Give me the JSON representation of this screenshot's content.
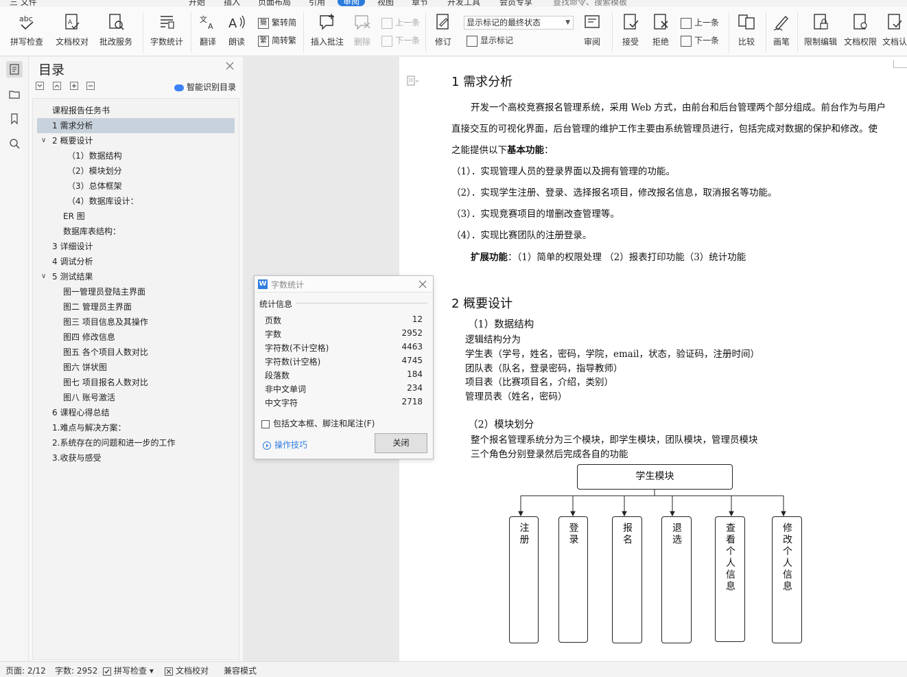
{
  "menu": {
    "items": [
      "三 文件",
      "开始",
      "插入",
      "页面布局",
      "引用",
      "审阅",
      "视图",
      "章节",
      "开发工具",
      "会员专享",
      "查找命令、搜索模板"
    ],
    "active_index": 5
  },
  "ribbon": {
    "spell_check": "拼写检查",
    "doc_proof": "文档校对",
    "batch_service": "批改服务",
    "word_count": "字数统计",
    "translate": "翻译",
    "read_aloud": "朗读",
    "trad_to_simp": "繁转简",
    "simp_to_trad": "简转繁",
    "insert_comment": "插入批注",
    "delete": "删除",
    "prev_comment": "上一条",
    "next_comment": "下一条",
    "revise": "修订",
    "markup_combo": "显示标记的最终状态",
    "show_markup": "显示标记",
    "review": "审阅",
    "accept": "接受",
    "reject": "拒绝",
    "prev_change": "上一条",
    "next_change": "下一条",
    "compare": "比较",
    "ink": "画笔",
    "restrict_edit": "限制编辑",
    "doc_permission": "文档权限",
    "doc_auth": "文档认"
  },
  "toc": {
    "title": "目录",
    "smart_label": "智能识别目录",
    "items": [
      {
        "label": "课程报告任务书",
        "indent": 0,
        "chev": ""
      },
      {
        "label": "1 需求分析",
        "indent": 0,
        "chev": "",
        "selected": true
      },
      {
        "label": "2 概要设计",
        "indent": 0,
        "chev": "v"
      },
      {
        "label": "（1）数据结构",
        "indent": 2,
        "chev": ""
      },
      {
        "label": "（2）模块划分",
        "indent": 2,
        "chev": ""
      },
      {
        "label": "（3）总体框架",
        "indent": 2,
        "chev": ""
      },
      {
        "label": "（4）数据库设计：",
        "indent": 2,
        "chev": ""
      },
      {
        "label": "ER 图",
        "indent": 1,
        "chev": ""
      },
      {
        "label": "数据库表结构：",
        "indent": 1,
        "chev": ""
      },
      {
        "label": "3 详细设计",
        "indent": 0,
        "chev": ""
      },
      {
        "label": "4 调试分析",
        "indent": 0,
        "chev": ""
      },
      {
        "label": "5   测试结果",
        "indent": 0,
        "chev": "v"
      },
      {
        "label": "图一管理员登陆主界面",
        "indent": 1,
        "chev": ""
      },
      {
        "label": "图二  管理员主界面",
        "indent": 1,
        "chev": ""
      },
      {
        "label": "图三  项目信息及其操作",
        "indent": 1,
        "chev": ""
      },
      {
        "label": "图四  修改信息",
        "indent": 1,
        "chev": ""
      },
      {
        "label": "图五  各个项目人数对比",
        "indent": 1,
        "chev": ""
      },
      {
        "label": "图六  饼状图",
        "indent": 1,
        "chev": ""
      },
      {
        "label": "图七  项目报名人数对比",
        "indent": 1,
        "chev": ""
      },
      {
        "label": "图八  账号激活",
        "indent": 1,
        "chev": ""
      },
      {
        "label": "6 课程心得总结",
        "indent": 0,
        "chev": ""
      },
      {
        "label": "1.难点与解决方案：",
        "indent": 0,
        "chev": ""
      },
      {
        "label": "2.系统存在的问题和进一步的工作",
        "indent": 0,
        "chev": ""
      },
      {
        "label": "3.收获与感受",
        "indent": 0,
        "chev": ""
      }
    ]
  },
  "doc": {
    "h1": "1  需求分析",
    "p1a": "开发一个高校竞赛报名管理系统，采用 Web 方式，由前台和后台管理两个部分组成。前台作为与用户",
    "p1b": "直接交互的可视化界面，后台管理的维护工作主要由系统管理员进行，包括完成对数据的保护和修改。使",
    "p1c_pre": "之能提供以下",
    "p1c_bold": "基本功能",
    "p1c_post": "：",
    "f1": "（1）．实现管理人员的登录界面以及拥有管理的功能。",
    "f2": "（2）．实现学生注册、登录、选择报名项目，修改报名信息，取消报名等功能。",
    "f3": "（3）．实现竞赛项目的增删改查管理等。",
    "f4": "（4）．实现比赛团队的注册登录。",
    "ext_bold": "扩展功能",
    "ext_text": "：（1）简单的权限处理  （2）报表打印功能（3）统计功能",
    "h2": "2  概要设计",
    "s1": "（1）数据结构",
    "l1": "逻辑结构分为",
    "l2": "学生表（学号，姓名，密码，学院，email，状态，验证码，注册时间）",
    "l3": "团队表（队名，登录密码，指导教师）",
    "l4": "项目表（比赛项目名，介绍，类别）",
    "l5": "管理员表（姓名，密码）",
    "s2": "（2）模块划分",
    "m1": "整个报名管理系统分为三个模块，即学生模块，团队模块，管理员模块",
    "m2": "三个角色分别登录然后完成各自的功能",
    "diagram": {
      "root": "学生模块",
      "children": [
        "注册",
        "登录",
        "报名",
        "退选",
        "查看个人信息",
        "修改个人信息"
      ]
    }
  },
  "dialog": {
    "title": "字数统计",
    "group": "统计信息",
    "rows": [
      {
        "k": "页数",
        "v": "12"
      },
      {
        "k": "字数",
        "v": "2952"
      },
      {
        "k": "字符数(不计空格)",
        "v": "4463"
      },
      {
        "k": "字符数(计空格)",
        "v": "4745"
      },
      {
        "k": "段落数",
        "v": "184"
      },
      {
        "k": "非中文单词",
        "v": "234"
      },
      {
        "k": "中文字符",
        "v": "2718"
      }
    ],
    "checkbox": "包括文本框、脚注和尾注(F)",
    "tips": "操作技巧",
    "close": "关闭"
  },
  "status": {
    "page": "页面: 2/12",
    "words": "字数: 2952",
    "spell": "拼写检查",
    "proof": "文档校对",
    "compat": "兼容模式"
  },
  "colors": {
    "accent": "#2b7bdc",
    "selected_toc": "#c8d2dc"
  }
}
